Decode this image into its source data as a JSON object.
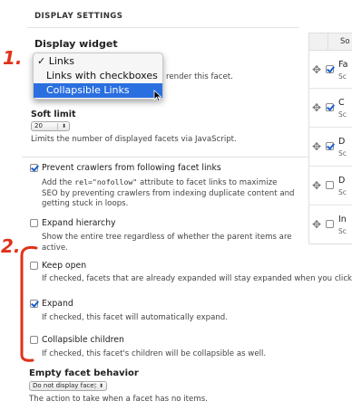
{
  "display_settings": {
    "title": "DISPLAY SETTINGS",
    "widget": {
      "label": "Display widget",
      "description_visible": "render this facet.",
      "options": [
        "Links",
        "Links with checkboxes",
        "Collapsible Links"
      ],
      "selected": "Links",
      "highlighted": "Collapsible Links",
      "check_glyph": "✓"
    },
    "soft_limit": {
      "label": "Soft limit",
      "value": "20",
      "description": "Limits the number of displayed facets via JavaScript."
    },
    "prevent_crawlers": {
      "label": "Prevent crawlers from following facet links",
      "checked": true,
      "desc_pre": "Add the ",
      "desc_code": "rel=\"nofollow\"",
      "desc_line1_post": " attribute to facet links to maximize",
      "desc_line2": "SEO by preventing crawlers from indexing duplicate content and",
      "desc_line3": "getting stuck in loops."
    },
    "expand_hierarchy": {
      "label": "Expand hierarchy",
      "checked": false,
      "desc_line1": "Show the entire tree regardless of whether the parent items are",
      "desc_line2": "active."
    },
    "keep_open": {
      "label": "Keep open",
      "checked": false,
      "description": "If checked, facets that are already expanded will stay expanded when you click"
    },
    "expand": {
      "label": "Expand",
      "checked": true,
      "description": "If checked, this facet will automatically expand."
    },
    "collapsible_children": {
      "label": "Collapsible children",
      "checked": false,
      "description": "If checked, this facet's children will be collapsible as well."
    },
    "empty_behavior": {
      "label": "Empty facet behavior",
      "value": "Do not display facet",
      "description": "The action to take when a facet has no items."
    }
  },
  "sort_table": {
    "header": "So",
    "rows": [
      {
        "name": "Fa",
        "sub": "Sc",
        "checked": true
      },
      {
        "name": "C",
        "sub": "Sc",
        "checked": true
      },
      {
        "name": "D",
        "sub": "Sc",
        "checked": true
      },
      {
        "name": "D",
        "sub": "Sc",
        "checked": false
      },
      {
        "name": "In",
        "sub": "Sc",
        "checked": false
      }
    ],
    "drag_glyph": "✥"
  },
  "annotations": {
    "one": "1.",
    "two": "2.",
    "color": "#e03219"
  },
  "colors": {
    "accent": "#2a6fe0",
    "check": "#1a5fd2"
  }
}
